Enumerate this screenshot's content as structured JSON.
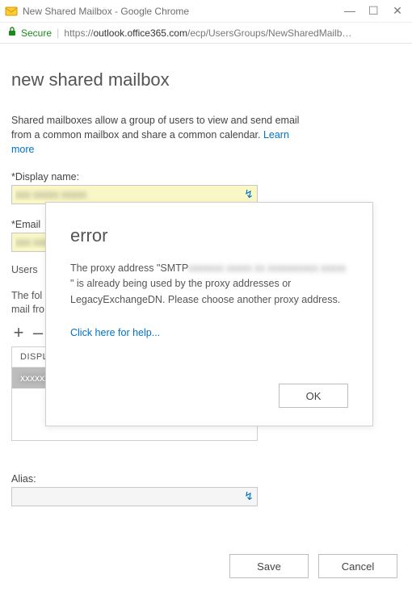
{
  "window": {
    "title": "New Shared Mailbox - Google Chrome",
    "minimize": "—",
    "maximize": "☐",
    "close": "✕"
  },
  "addressbar": {
    "secure_label": "Secure",
    "url_prefix": "https://",
    "url_domain": "outlook.office365.com",
    "url_path": "/ecp/UsersGroups/NewSharedMailb…"
  },
  "page": {
    "title": "new shared mailbox",
    "intro_text": "Shared mailboxes allow a group of users to view and send email from a common mailbox and share a common calendar. ",
    "learn_more": "Learn more",
    "display_name_label": "*Display name:",
    "display_name_value": "xxx xxxxx xxxxx",
    "email_label": "*Email",
    "email_value": "xxx xxxx",
    "users_heading": "Users",
    "users_desc_line1": "The fol",
    "users_desc_line2": "mail fro",
    "grid_header": "DISPL",
    "grid_row1": "xxxxxx",
    "alias_label": "Alias:",
    "alias_value": "",
    "save_label": "Save",
    "cancel_label": "Cancel",
    "plus": "+",
    "minus": "–"
  },
  "dialog": {
    "title": "error",
    "line_pre": "The proxy address \"SMTP",
    "smudge": " xxxxxxx xxxxx xx xxxxxxxxxx xxxxx",
    "line_post": "\" is already being used by the proxy addresses or LegacyExchangeDN. Please choose another proxy address.",
    "help_link": "Click here for help...",
    "ok_label": "OK"
  }
}
